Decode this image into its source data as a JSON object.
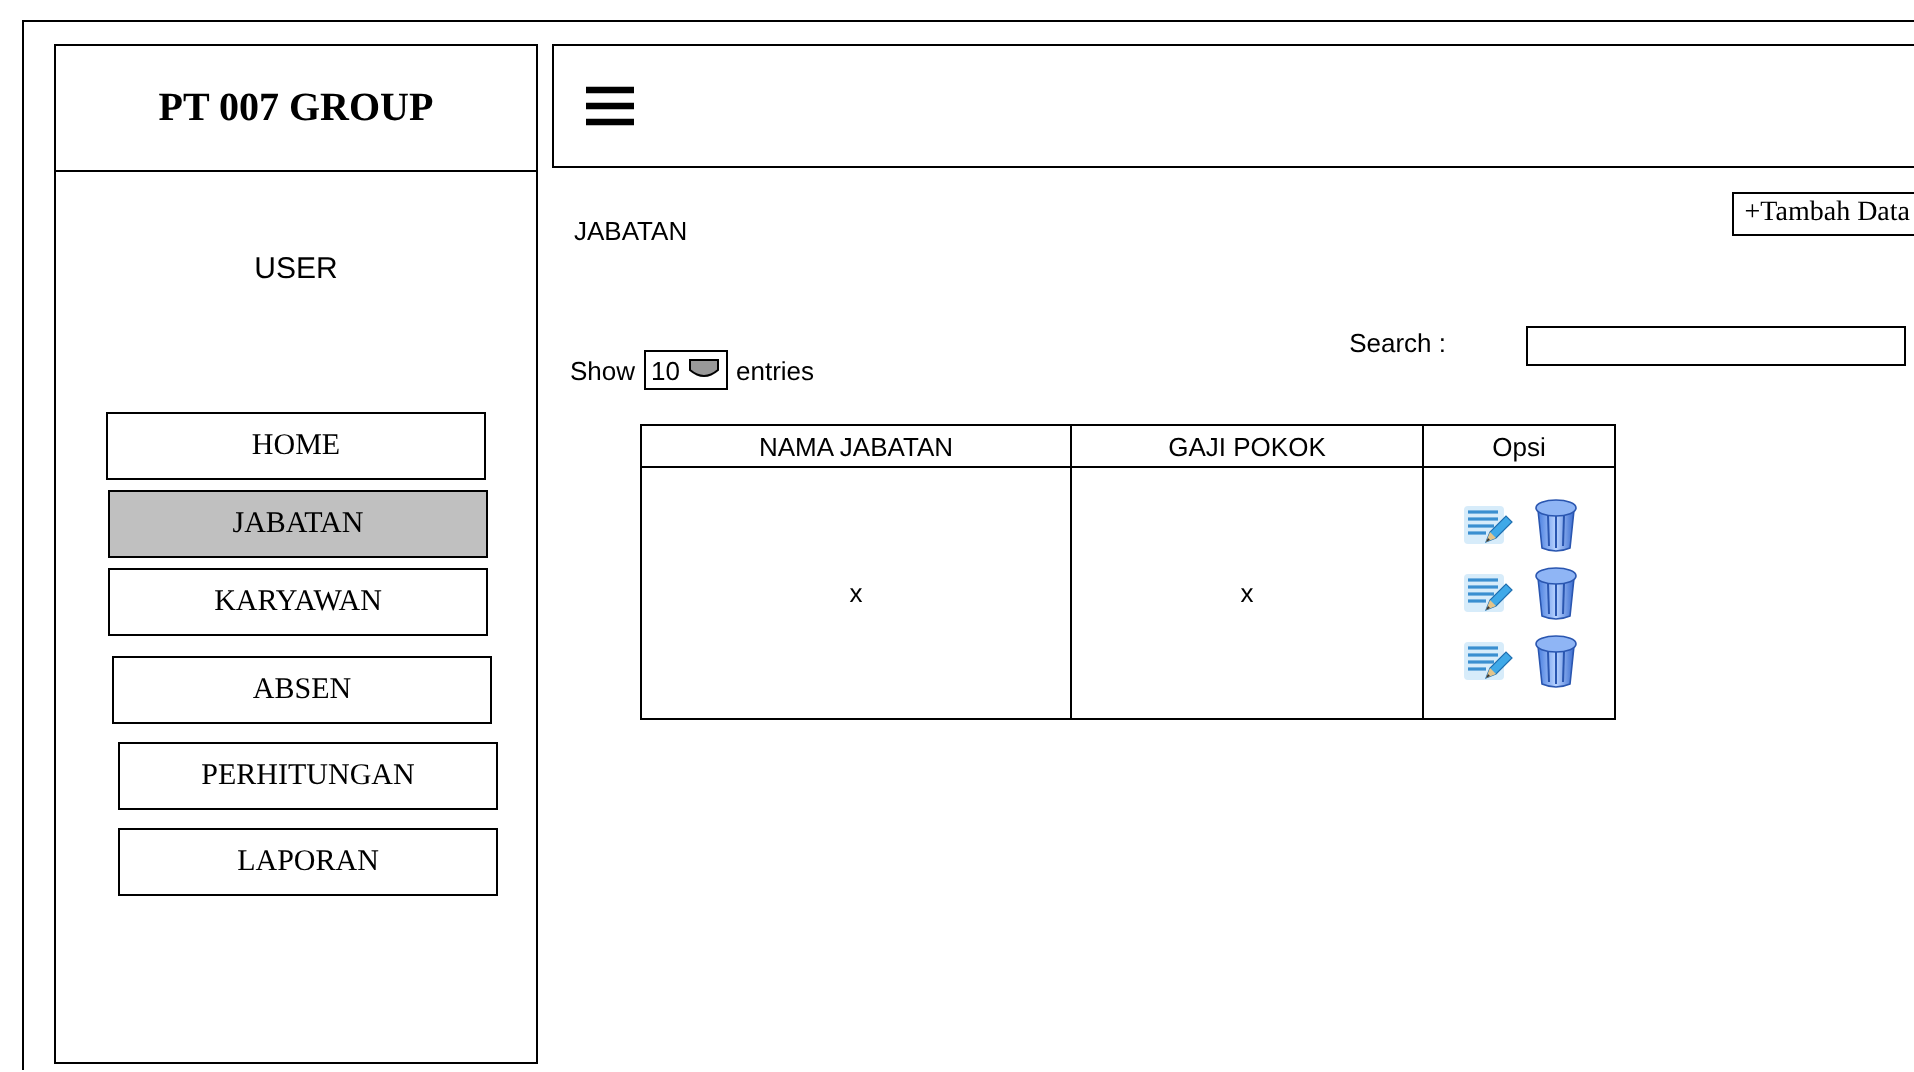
{
  "sidebar": {
    "brand": "PT 007 GROUP",
    "user": "USER",
    "items": [
      {
        "label": "HOME",
        "selected": false
      },
      {
        "label": "JABATAN",
        "selected": true
      },
      {
        "label": "KARYAWAN",
        "selected": false
      },
      {
        "label": "ABSEN",
        "selected": false
      },
      {
        "label": "PERHITUNGAN",
        "selected": false
      },
      {
        "label": "LAPORAN",
        "selected": false
      }
    ]
  },
  "page": {
    "title": "JABATAN",
    "add_button": "+Tambah Data",
    "show_label": "Show",
    "entries_value": "10",
    "entries_label": "entries",
    "search_label": "Search :"
  },
  "table": {
    "columns": [
      "NAMA JABATAN",
      "GAJI POKOK",
      "Opsi"
    ],
    "rows": [
      {
        "cells": [
          "x",
          "x"
        ],
        "options": [
          {
            "kind": "edit"
          },
          {
            "kind": "delete"
          },
          {
            "kind": "edit"
          },
          {
            "kind": "delete"
          },
          {
            "kind": "edit"
          },
          {
            "kind": "delete"
          }
        ]
      }
    ]
  }
}
